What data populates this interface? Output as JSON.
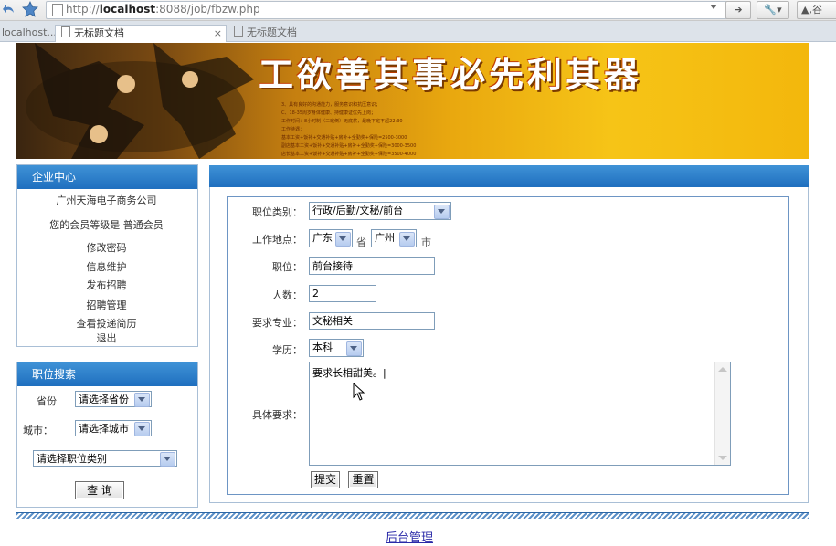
{
  "browser": {
    "url_prefix": "http://",
    "url_host": "localhost",
    "url_rest": ":8088/job/fbzw.php",
    "search_partial": "谷",
    "tabs": [
      {
        "label": "localhost..."
      },
      {
        "label": "无标题文档"
      },
      {
        "label": "无标题文档"
      }
    ]
  },
  "banner": {
    "slogan": "工欲善其事必先利其器",
    "lines": [
      "3、具有良好的沟通能力，服务意识和抗压意识；",
      "C、18-35周岁身体健康、持健康证优先上岗；",
      "工作时间：8小时制（三班倒）无底薪，最晚下班不超22:30",
      "工作待遇：",
      "基本工资+饭补+交通补贴+房补+全勤奖+保险=2500-3000",
      "副店基本工资+饭补+交通补贴+房补+全勤奖+保险=3000-3500",
      "店长基本工资+饭补+交通补贴+房补+全勤奖+保险=3500-4000"
    ]
  },
  "sidebar": {
    "company_header": "企业中心",
    "company_name": "广州天海电子商务公司",
    "member_level": "您的会员等级是 普通会员",
    "links": [
      "修改密码",
      "信息维护",
      "发布招聘",
      "招聘管理",
      "查看投递简历",
      "退出"
    ],
    "search_header": "职位搜索",
    "province_label": "省份",
    "province_value": "请选择省份",
    "city_label": "城市：",
    "city_value": "请选择城市",
    "category_value": "请选择职位类别",
    "search_button": "查 询"
  },
  "form": {
    "category_label": "职位类别：",
    "category_value": "行政/后勤/文秘/前台",
    "location_label": "工作地点：",
    "province_value": "广东",
    "province_suffix": "省",
    "city_value": "广州",
    "city_suffix": "市",
    "position_label": "职位：",
    "position_value": "前台接待",
    "count_label": "人数：",
    "count_value": "2",
    "major_label": "要求专业：",
    "major_value": "文秘相关",
    "education_label": "学历：",
    "education_value": "本科",
    "requirements_label": "具体要求：",
    "requirements_value": "要求长相甜美。|",
    "submit_button": "提交",
    "reset_button": "重置"
  },
  "footer": {
    "admin_link": "后台管理"
  }
}
